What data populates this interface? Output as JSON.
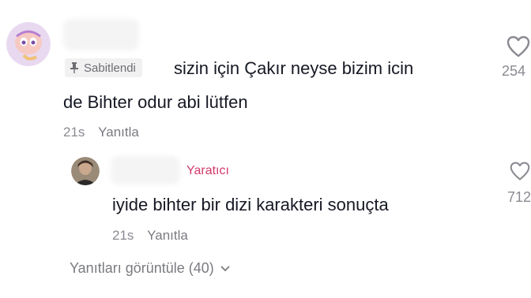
{
  "comment": {
    "pinned_label": "Sabitlendi",
    "text_line1": "sizin için Çakır neyse bizim icin",
    "text_line2": "de Bihter odur abi lütfen",
    "time": "21s",
    "reply_label": "Yanıtla",
    "like_count": "254"
  },
  "reply": {
    "creator_label": "Yaratıcı",
    "text": "iyide bihter bir dizi karakteri sonuçta",
    "time": "21s",
    "reply_label": "Yanıtla",
    "like_count": "712"
  },
  "view_replies_label": "Yanıtları görüntüle (40)",
  "icons": {
    "pin": "pin-icon",
    "heart": "heart-icon",
    "chevron": "chevron-down-icon"
  },
  "colors": {
    "creator_accent": "#d23a6a",
    "meta_gray": "#8a8b91"
  }
}
